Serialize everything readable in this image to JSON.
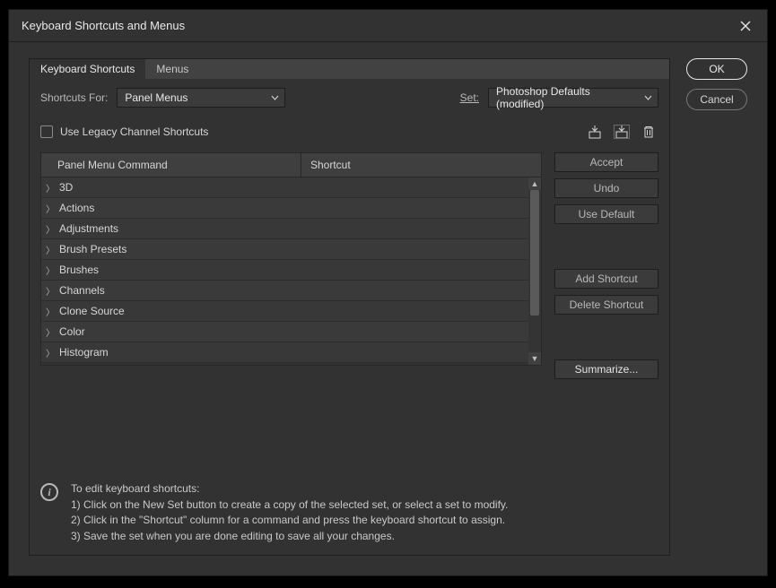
{
  "dialog": {
    "title": "Keyboard Shortcuts and Menus"
  },
  "side": {
    "ok": "OK",
    "cancel": "Cancel"
  },
  "tabs": {
    "shortcuts": "Keyboard Shortcuts",
    "menus": "Menus"
  },
  "row1": {
    "shortcuts_for_label": "Shortcuts For:",
    "shortcuts_for_value": "Panel Menus",
    "set_label": "Set:",
    "set_value": "Photoshop Defaults (modified)"
  },
  "row2": {
    "legacy_label": "Use Legacy Channel Shortcuts"
  },
  "table": {
    "col_command": "Panel Menu Command",
    "col_shortcut": "Shortcut",
    "rows": [
      {
        "name": "3D"
      },
      {
        "name": "Actions"
      },
      {
        "name": "Adjustments"
      },
      {
        "name": "Brush Presets"
      },
      {
        "name": "Brushes"
      },
      {
        "name": "Channels"
      },
      {
        "name": "Clone Source"
      },
      {
        "name": "Color"
      },
      {
        "name": "Histogram"
      }
    ]
  },
  "buttons": {
    "accept": "Accept",
    "undo": "Undo",
    "use_default": "Use Default",
    "add_shortcut": "Add Shortcut",
    "delete_shortcut": "Delete Shortcut",
    "summarize": "Summarize..."
  },
  "help": {
    "heading": "To edit keyboard shortcuts:",
    "line1": "1) Click on the New Set button to create a copy of the selected set, or select a set to modify.",
    "line2": "2) Click in the \"Shortcut\" column for a command and press the keyboard shortcut to assign.",
    "line3": "3) Save the set when you are done editing to save all your changes."
  }
}
